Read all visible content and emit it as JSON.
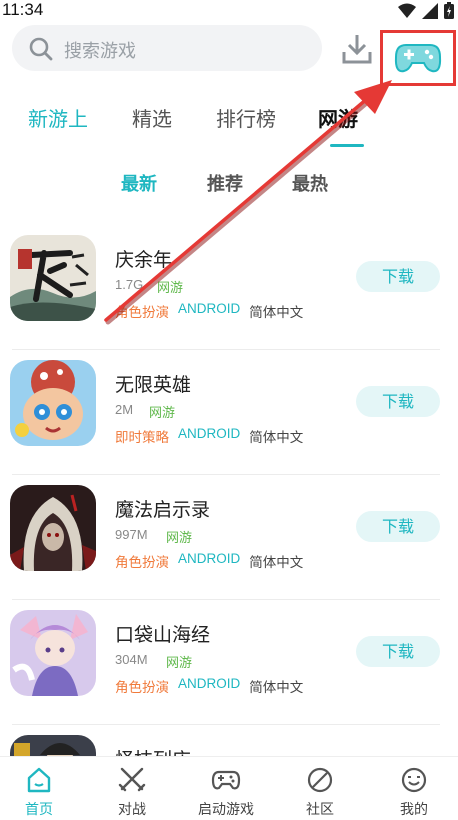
{
  "status_bar": {
    "time": "11:34"
  },
  "search": {
    "placeholder": "搜索游戏"
  },
  "tabs": [
    {
      "label": "新游上"
    },
    {
      "label": "精选"
    },
    {
      "label": "排行榜"
    },
    {
      "label": "网游"
    }
  ],
  "subtabs": [
    {
      "label": "最新"
    },
    {
      "label": "推荐"
    },
    {
      "label": "最热"
    }
  ],
  "games": [
    {
      "name": "庆余年",
      "size": "1.7G",
      "type": "网游",
      "genre": "角色扮演",
      "platform": "ANDROID",
      "language": "简体中文",
      "button": "下载"
    },
    {
      "name": "无限英雄",
      "size": "2M",
      "type": "网游",
      "genre": "即时策略",
      "platform": "ANDROID",
      "language": "简体中文",
      "button": "下载"
    },
    {
      "name": "魔法启示录",
      "size": "997M",
      "type": "网游",
      "genre": "角色扮演",
      "platform": "ANDROID",
      "language": "简体中文",
      "button": "下载"
    },
    {
      "name": "口袋山海经",
      "size": "304M",
      "type": "网游",
      "genre": "角色扮演",
      "platform": "ANDROID",
      "language": "简体中文",
      "button": "下载"
    },
    {
      "name": "怪技列店"
    }
  ],
  "bottom_nav": [
    {
      "label": "首页"
    },
    {
      "label": "对战"
    },
    {
      "label": "启动游戏"
    },
    {
      "label": "社区"
    },
    {
      "label": "我的"
    }
  ],
  "colors": {
    "accent": "#1fb7c1",
    "genre": "#f07a3b",
    "online": "#5fb84b",
    "annotation": "#e53935"
  }
}
